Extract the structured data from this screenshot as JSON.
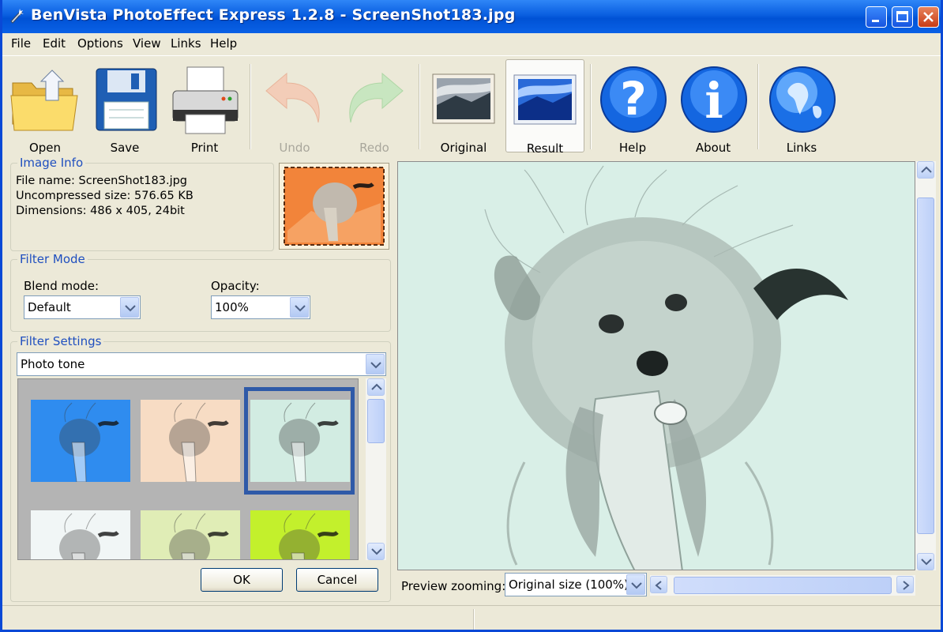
{
  "window": {
    "title": "BenVista PhotoEffect Express 1.2.8 - ScreenShot183.jpg"
  },
  "menu": [
    "File",
    "Edit",
    "Options",
    "View",
    "Links",
    "Help"
  ],
  "toolbar": {
    "open": "Open",
    "save": "Save",
    "print": "Print",
    "undo": "Undo",
    "redo": "Redo",
    "original": "Original",
    "result": "Result",
    "help": "Help",
    "about": "About",
    "links": "Links"
  },
  "image_info": {
    "title": "Image Info",
    "file_name": "File name: ScreenShot183.jpg",
    "size": "Uncompressed size: 576.65 KB",
    "dimensions": "Dimensions: 486 x 405, 24bit"
  },
  "filter_mode": {
    "title": "Filter Mode",
    "blend_label": "Blend mode:",
    "blend_value": "Default",
    "opacity_label": "Opacity:",
    "opacity_value": "100%"
  },
  "filter_settings": {
    "title": "Filter Settings",
    "preset": "Photo tone",
    "swatch_colors": [
      "#2f8cef",
      "#f7dcc4",
      "#d2ece2",
      "#f1f6f6",
      "#e0edb6",
      "#c3f02c"
    ],
    "selected_swatch": 3
  },
  "buttons": {
    "ok": "OK",
    "cancel": "Cancel"
  },
  "preview": {
    "zoom_label": "Preview zooming:",
    "zoom_value": "Original size (100%)",
    "tint": "#d9efe7"
  },
  "colors": {
    "accent": "#0a5fe0",
    "group_title": "#1f4fbf"
  }
}
